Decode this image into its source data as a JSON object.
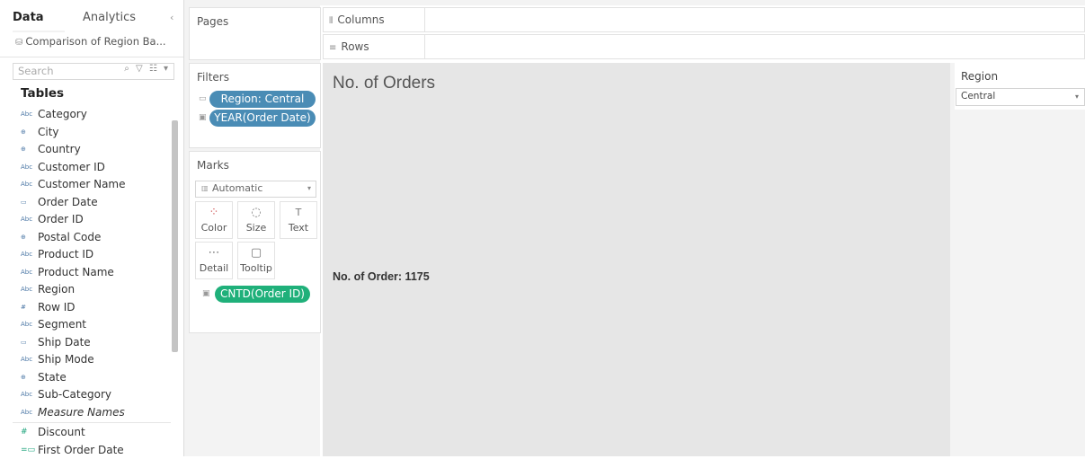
{
  "tabs": {
    "data": "Data",
    "analytics": "Analytics",
    "collapse": "‹"
  },
  "datasource": {
    "icon": "datasource-icon",
    "label": "Comparison of Region Ba..."
  },
  "search": {
    "placeholder": "Search",
    "tool_icons": "⌕ ▽ ☷ ▾"
  },
  "tables_title": "Tables",
  "dimensions": [
    {
      "label": "Category",
      "icon": "Abc",
      "italic": false
    },
    {
      "label": "City",
      "icon": "⊕",
      "italic": false
    },
    {
      "label": "Country",
      "icon": "⊕",
      "italic": false
    },
    {
      "label": "Customer ID",
      "icon": "Abc",
      "italic": false
    },
    {
      "label": "Customer Name",
      "icon": "Abc",
      "italic": false
    },
    {
      "label": "Order Date",
      "icon": "▭",
      "italic": false
    },
    {
      "label": "Order ID",
      "icon": "Abc",
      "italic": false
    },
    {
      "label": "Postal Code",
      "icon": "⊕",
      "italic": false
    },
    {
      "label": "Product ID",
      "icon": "Abc",
      "italic": false
    },
    {
      "label": "Product Name",
      "icon": "Abc",
      "italic": false
    },
    {
      "label": "Region",
      "icon": "Abc",
      "italic": false
    },
    {
      "label": "Row ID",
      "icon": "#",
      "italic": false
    },
    {
      "label": "Segment",
      "icon": "Abc",
      "italic": false
    },
    {
      "label": "Ship Date",
      "icon": "▭",
      "italic": false
    },
    {
      "label": "Ship Mode",
      "icon": "Abc",
      "italic": false
    },
    {
      "label": "State",
      "icon": "⊕",
      "italic": false
    },
    {
      "label": "Sub-Category",
      "icon": "Abc",
      "italic": false
    },
    {
      "label": "Measure Names",
      "icon": "Abc",
      "italic": true
    }
  ],
  "measures": [
    {
      "label": "Discount",
      "icon": "#"
    },
    {
      "label": "First Order Date",
      "icon": "=▭"
    }
  ],
  "pages": {
    "title": "Pages"
  },
  "filters": {
    "title": "Filters",
    "items": [
      {
        "label": "Region: Central",
        "icon": "▭"
      },
      {
        "label": "YEAR(Order Date)",
        "icon": "▣"
      }
    ]
  },
  "marks": {
    "title": "Marks",
    "type": "Automatic",
    "buttons": [
      {
        "label": "Color",
        "icon": "⁘"
      },
      {
        "label": "Size",
        "icon": "◌"
      },
      {
        "label": "Text",
        "icon": "T"
      },
      {
        "label": "Detail",
        "icon": "⋯"
      },
      {
        "label": "Tooltip",
        "icon": "▢"
      }
    ],
    "field": "CNTD(Order ID)"
  },
  "shelves": {
    "columns": "Columns",
    "rows": "Rows"
  },
  "view": {
    "title": "No. of Orders",
    "text": "No. of Order: 1175"
  },
  "region_filter": {
    "title": "Region",
    "value": "Central"
  },
  "colors": {
    "pill_blue": "#4a8cb5",
    "pill_green": "#1fb07a",
    "view_bg": "#e6e6e6"
  }
}
